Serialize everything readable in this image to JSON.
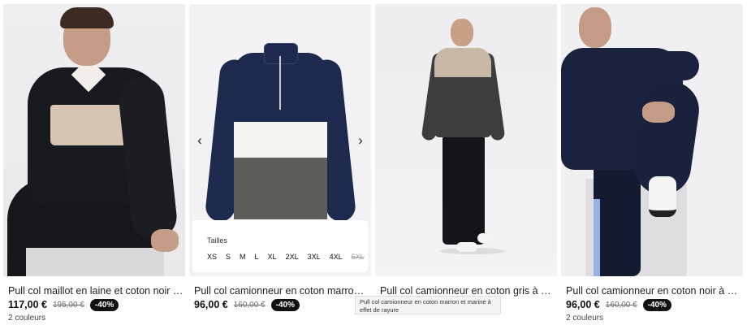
{
  "products": [
    {
      "name": "Pull col maillot en laine et coton noir gri...",
      "price": "117,00 €",
      "old_price": "195,00 €",
      "discount": "-40%",
      "colors": "2 couleurs"
    },
    {
      "name": "Pull col camionneur en coton marron et ...",
      "price": "96,00 €",
      "old_price": "160,00 €",
      "discount": "-40%",
      "sizes_label": "Tailles",
      "sizes": [
        "XS",
        "S",
        "M",
        "L",
        "XL",
        "2XL",
        "3XL",
        "4XL",
        "5XL"
      ],
      "unavailable_size": "5XL",
      "arrow_left": "‹",
      "arrow_right": "›"
    },
    {
      "name": "Pull col camionneur en coton gris à effe..."
    },
    {
      "name": "Pull col camionneur en coton noir à man...",
      "price": "96,00 €",
      "old_price": "160,00 €",
      "discount": "-40%",
      "colors": "2 couleurs"
    }
  ],
  "tooltip": "Pull col camionneur en coton marron et marine à effet de rayure"
}
